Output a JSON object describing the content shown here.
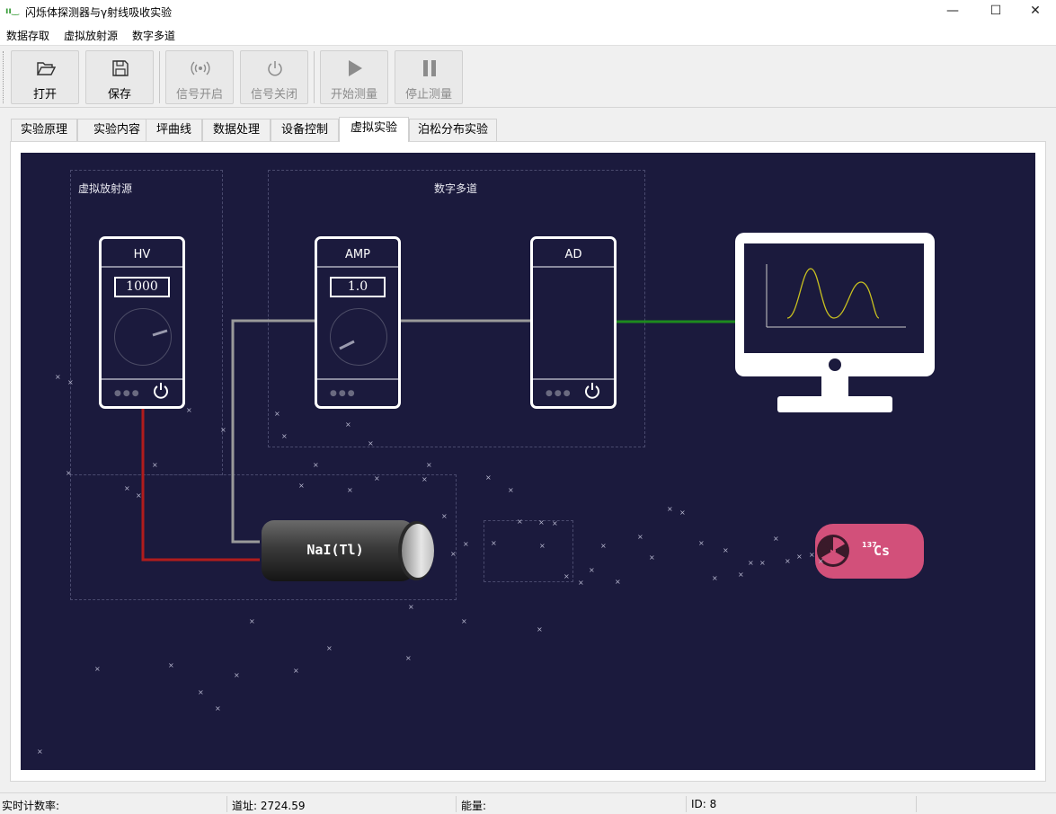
{
  "window": {
    "title": "闪烁体探测器与γ射线吸收实验",
    "icon_text": "ıı‿",
    "min": "—",
    "max": "☐",
    "close": "✕"
  },
  "menu": [
    "数据存取",
    "虚拟放射源",
    "数字多道"
  ],
  "toolbar": {
    "open": "打开",
    "save": "保存",
    "signal_on": "信号开启",
    "signal_off": "信号关闭",
    "start": "开始测量",
    "stop": "停止测量"
  },
  "tabs": [
    "实验原理",
    "实验内容",
    "坪曲线",
    "数据处理",
    "设备控制",
    "虚拟实验",
    "泊松分布实验"
  ],
  "active_tab": "虚拟实验",
  "scene": {
    "source_group_label": "虚拟放射源",
    "mca_group_label": "数字多道",
    "hv": {
      "name": "HV",
      "value": "1000"
    },
    "amp": {
      "name": "AMP",
      "value": "1.0"
    },
    "ad": {
      "name": "AD"
    },
    "detector_label": "NaI(Tl)",
    "source_mass": "137",
    "source_element": "Cs",
    "colors": {
      "background": "#1b1a3d",
      "hv_wire": "#b01c1c",
      "signal_wire": "#9a9a9a",
      "ad_wire": "#1e8a1e",
      "source": "#d2507a",
      "spectrum": "#c8c020"
    }
  },
  "status": {
    "count_rate": "实时计数率:",
    "channel": "道址: 2724.59",
    "energy": "能量:",
    "id": "ID: 8"
  }
}
